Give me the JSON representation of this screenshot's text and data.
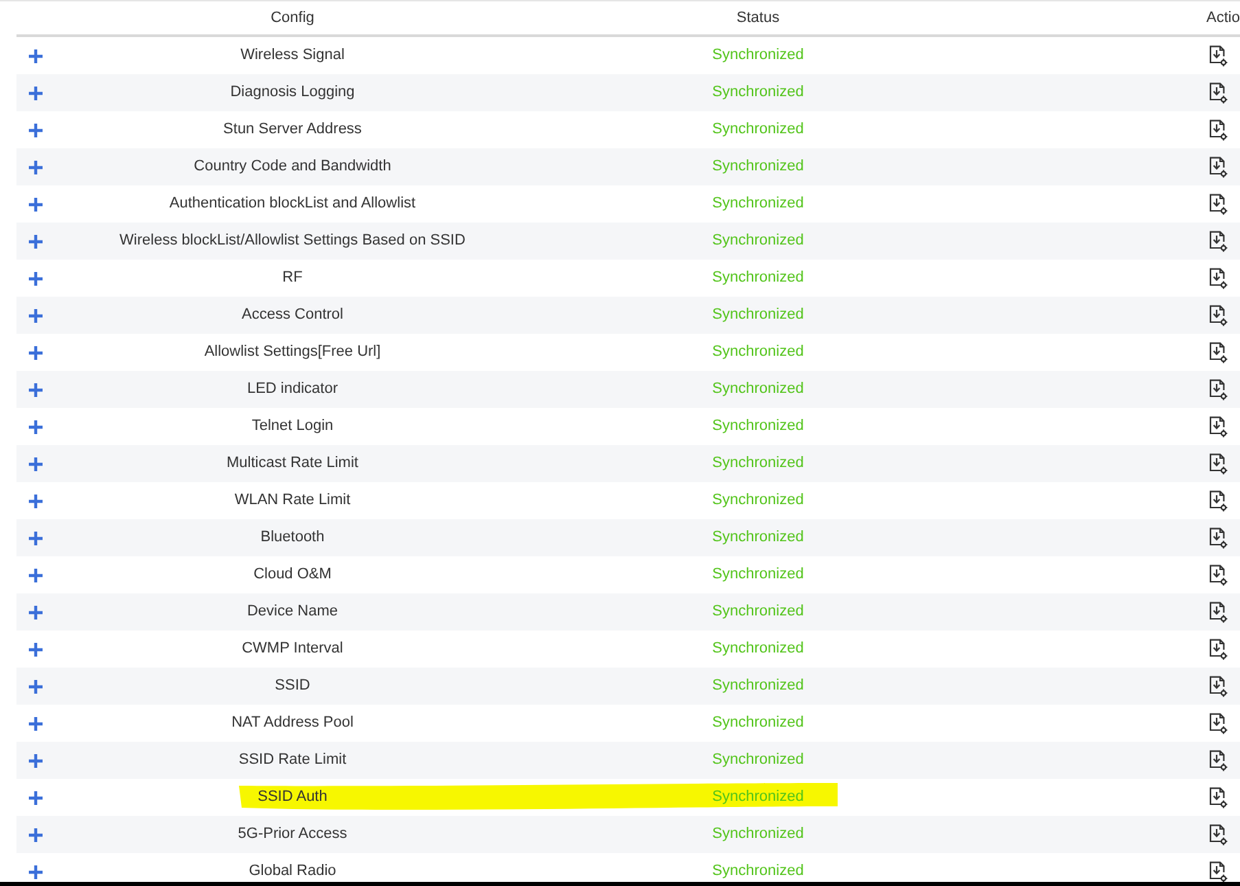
{
  "table": {
    "columns": [
      "Config",
      "Status",
      "Actio"
    ],
    "rows": [
      {
        "config": "Wireless Signal",
        "status": "Synchronized",
        "highlighted": false
      },
      {
        "config": "Diagnosis Logging",
        "status": "Synchronized",
        "highlighted": false
      },
      {
        "config": "Stun Server Address",
        "status": "Synchronized",
        "highlighted": false
      },
      {
        "config": "Country Code and Bandwidth",
        "status": "Synchronized",
        "highlighted": false
      },
      {
        "config": "Authentication blockList and Allowlist",
        "status": "Synchronized",
        "highlighted": false
      },
      {
        "config": "Wireless blockList/Allowlist Settings Based on SSID",
        "status": "Synchronized",
        "highlighted": false
      },
      {
        "config": "RF",
        "status": "Synchronized",
        "highlighted": false
      },
      {
        "config": "Access Control",
        "status": "Synchronized",
        "highlighted": false
      },
      {
        "config": "Allowlist Settings[Free Url]",
        "status": "Synchronized",
        "highlighted": false
      },
      {
        "config": "LED indicator",
        "status": "Synchronized",
        "highlighted": false
      },
      {
        "config": "Telnet Login",
        "status": "Synchronized",
        "highlighted": false
      },
      {
        "config": "Multicast Rate Limit",
        "status": "Synchronized",
        "highlighted": false
      },
      {
        "config": "WLAN Rate Limit",
        "status": "Synchronized",
        "highlighted": false
      },
      {
        "config": "Bluetooth",
        "status": "Synchronized",
        "highlighted": false
      },
      {
        "config": "Cloud O&M",
        "status": "Synchronized",
        "highlighted": false
      },
      {
        "config": "Device Name",
        "status": "Synchronized",
        "highlighted": false
      },
      {
        "config": "CWMP Interval",
        "status": "Synchronized",
        "highlighted": false
      },
      {
        "config": "SSID",
        "status": "Synchronized",
        "highlighted": false
      },
      {
        "config": "NAT Address Pool",
        "status": "Synchronized",
        "highlighted": false
      },
      {
        "config": "SSID Rate Limit",
        "status": "Synchronized",
        "highlighted": false
      },
      {
        "config": "SSID Auth",
        "status": "Synchronized",
        "highlighted": true
      },
      {
        "config": "5G-Prior Access",
        "status": "Synchronized",
        "highlighted": false
      },
      {
        "config": "Global Radio",
        "status": "Synchronized",
        "highlighted": false
      }
    ]
  }
}
